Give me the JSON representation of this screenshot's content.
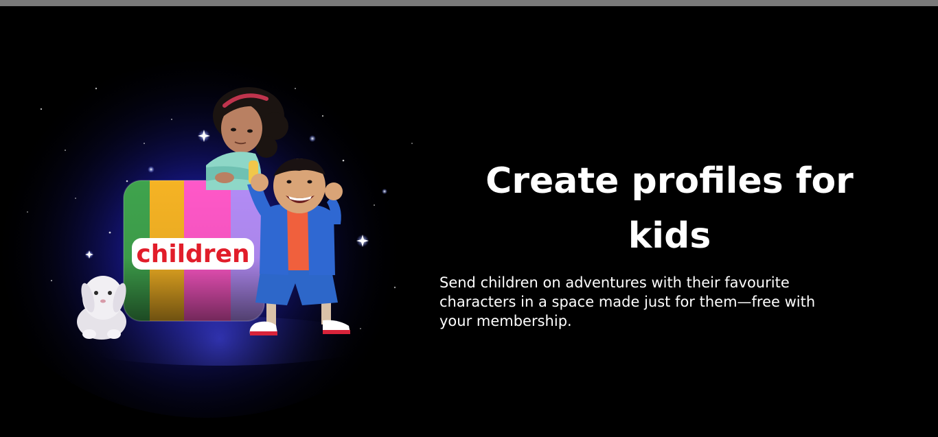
{
  "feature": {
    "title": "Create profiles for kids",
    "description": "Send children on adventures with their favourite characters in a space made just for them—free with your membership."
  },
  "illustration": {
    "tile_label": "children",
    "label_color": "#e11d2a",
    "stripe_colors": [
      "#3fa34d",
      "#f5b324",
      "#ee5a9b",
      "#ff5fd0",
      "#b28cf5"
    ]
  }
}
